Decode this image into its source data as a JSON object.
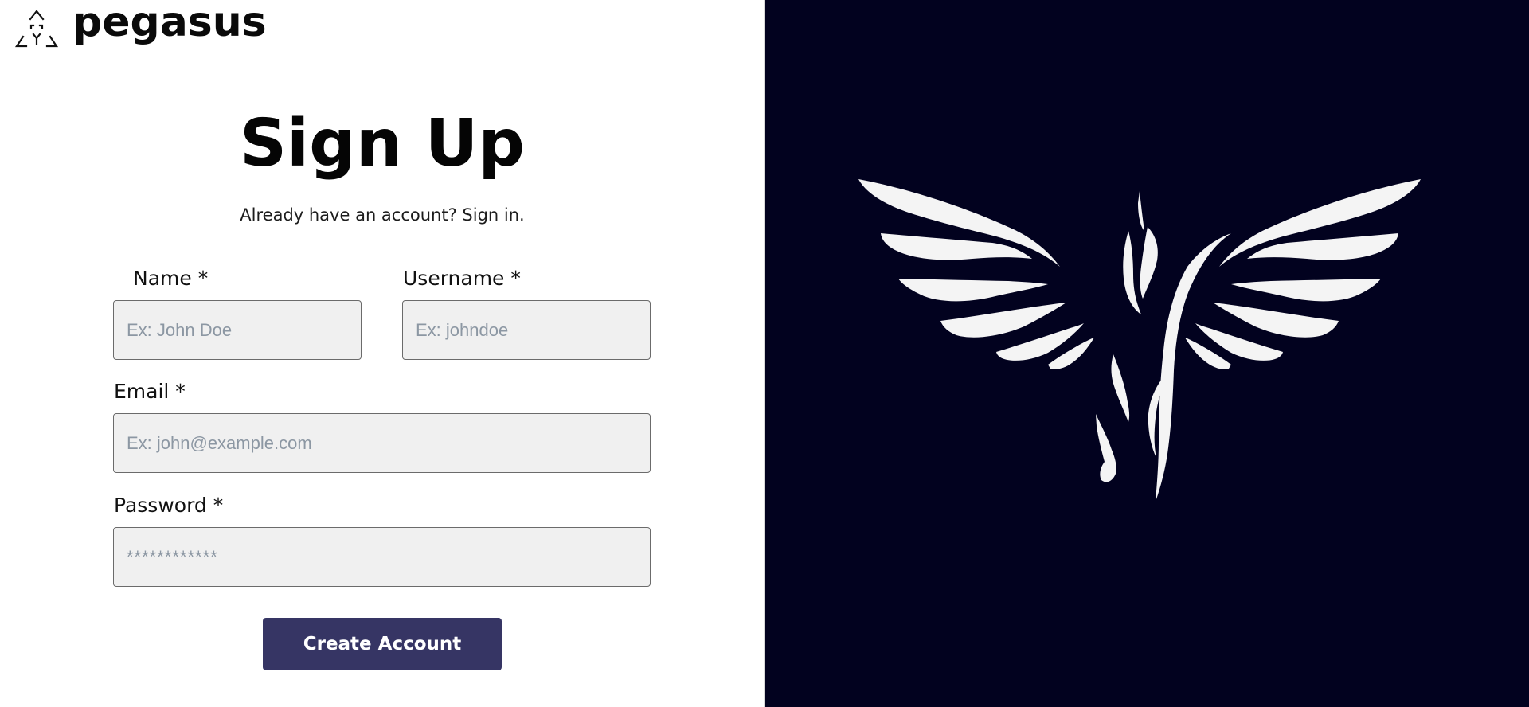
{
  "brand": {
    "name": "pegasus"
  },
  "signup": {
    "title": "Sign Up",
    "subtitle": "Already have an account? Sign in."
  },
  "form": {
    "name": {
      "label": "Name *",
      "placeholder": "Ex: John Doe",
      "value": ""
    },
    "username": {
      "label": "Username *",
      "placeholder": "Ex: johndoe",
      "value": ""
    },
    "email": {
      "label": "Email *",
      "placeholder": "Ex: john@example.com",
      "value": ""
    },
    "password": {
      "label": "Password *",
      "placeholder": "************",
      "value": ""
    },
    "submit_label": "Create Account"
  },
  "colors": {
    "accent": "#363564",
    "hero_background": "#02021f",
    "input_background": "#f0f0f0"
  },
  "icons": {
    "logo": "triangle-logo-icon",
    "hero": "winged-pegasus-icon"
  }
}
